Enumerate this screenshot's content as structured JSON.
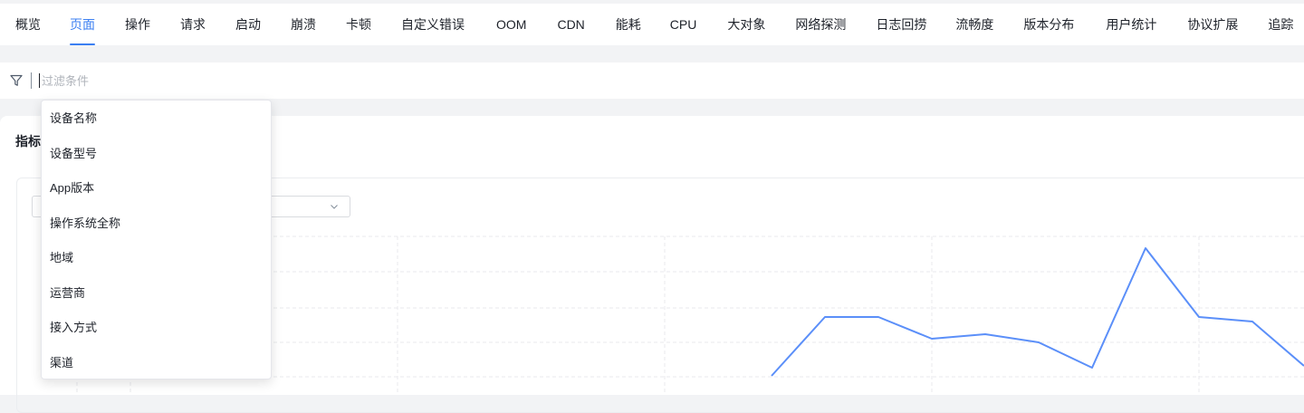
{
  "tabs": [
    {
      "label": "概览",
      "active": false
    },
    {
      "label": "页面",
      "active": true
    },
    {
      "label": "操作",
      "active": false
    },
    {
      "label": "请求",
      "active": false
    },
    {
      "label": "启动",
      "active": false
    },
    {
      "label": "崩溃",
      "active": false
    },
    {
      "label": "卡顿",
      "active": false
    },
    {
      "label": "自定义错误",
      "active": false
    },
    {
      "label": "OOM",
      "active": false
    },
    {
      "label": "CDN",
      "active": false
    },
    {
      "label": "能耗",
      "active": false
    },
    {
      "label": "CPU",
      "active": false
    },
    {
      "label": "大对象",
      "active": false
    },
    {
      "label": "网络探测",
      "active": false
    },
    {
      "label": "日志回捞",
      "active": false
    },
    {
      "label": "流畅度",
      "active": false
    },
    {
      "label": "版本分布",
      "active": false
    },
    {
      "label": "用户统计",
      "active": false
    },
    {
      "label": "协议扩展",
      "active": false
    },
    {
      "label": "追踪",
      "active": false
    }
  ],
  "filter": {
    "placeholder": "过滤条件",
    "value": ""
  },
  "panel": {
    "title": "指标"
  },
  "dropdown": {
    "options": [
      "设备名称",
      "设备型号",
      "App版本",
      "操作系统全称",
      "地域",
      "运营商",
      "接入方式",
      "渠道"
    ]
  },
  "colors": {
    "accent": "#3b7ff2",
    "line": "#5b8ff9"
  },
  "icons": {
    "filter": "filter-icon",
    "select": "chevron-down-icon"
  }
}
